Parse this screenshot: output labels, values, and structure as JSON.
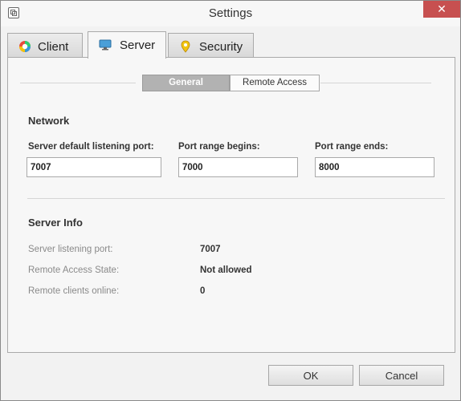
{
  "window": {
    "title": "Settings",
    "close_glyph": "✕"
  },
  "tabs": [
    {
      "label": "Client",
      "icon": "client-color-wheel-icon"
    },
    {
      "label": "Server",
      "icon": "monitor-icon",
      "active": true
    },
    {
      "label": "Security",
      "icon": "location-pin-icon"
    }
  ],
  "subtabs": [
    {
      "label": "General",
      "active": true
    },
    {
      "label": "Remote Access"
    }
  ],
  "network": {
    "title": "Network",
    "default_port_label": "Server default listening port:",
    "default_port_value": "7007",
    "range_begin_label": "Port range begins:",
    "range_begin_value": "7000",
    "range_end_label": "Port range ends:",
    "range_end_value": "8000"
  },
  "server_info": {
    "title": "Server Info",
    "rows": [
      {
        "label": "Server listening port:",
        "value": "7007"
      },
      {
        "label": "Remote Access State:",
        "value": "Not allowed"
      },
      {
        "label": "Remote clients online:",
        "value": "0"
      }
    ]
  },
  "buttons": {
    "ok": "OK",
    "cancel": "Cancel"
  },
  "colors": {
    "close_button": "#c75050",
    "active_subtab": "#b2b2b2"
  }
}
